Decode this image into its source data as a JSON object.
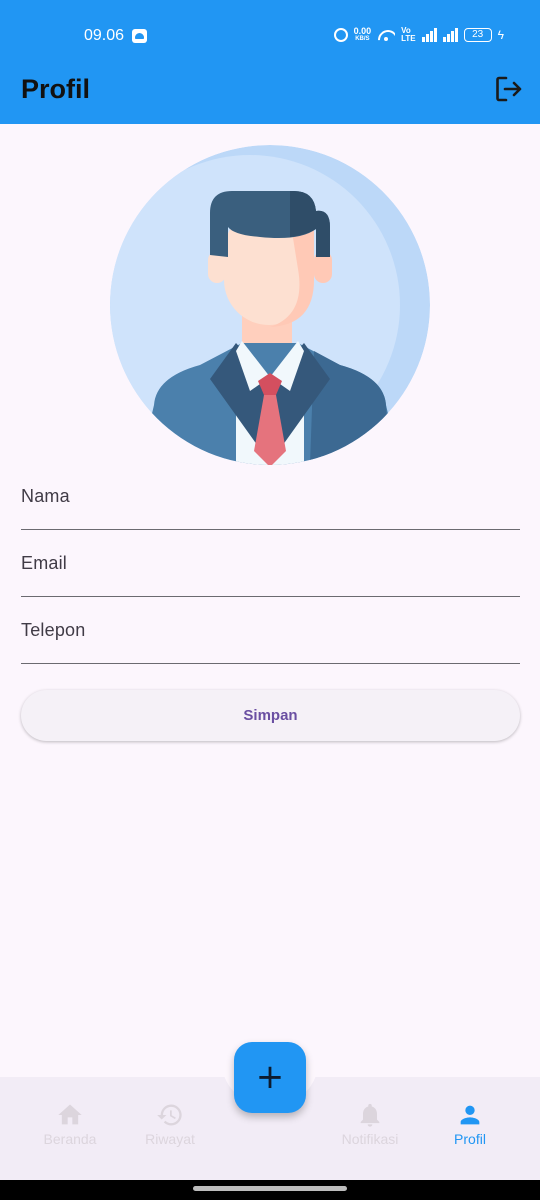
{
  "status_bar": {
    "time": "09.06",
    "net_speed_value": "0.00",
    "net_speed_unit": "KB/S",
    "volte_top": "Vo",
    "volte_bottom": "LTE",
    "battery": "23"
  },
  "app_bar": {
    "title": "Profil",
    "logout_icon": "logout-icon",
    "background_color": "#2196f3"
  },
  "avatar": {
    "icon": "businessman-avatar"
  },
  "form": {
    "fields": [
      {
        "label": "Nama"
      },
      {
        "label": "Email"
      },
      {
        "label": "Telepon"
      }
    ],
    "save_label": "Simpan"
  },
  "fab": {
    "symbol": "+",
    "icon": "add-icon"
  },
  "bottom_nav": {
    "items": [
      {
        "label": "Beranda",
        "icon": "home-icon",
        "active": false
      },
      {
        "label": "Riwayat",
        "icon": "history-icon",
        "active": false
      },
      {
        "label": "Notifikasi",
        "icon": "bell-icon",
        "active": false
      },
      {
        "label": "Profil",
        "icon": "person-icon",
        "active": true
      }
    ],
    "active_color": "#2196f3",
    "inactive_color": "#dcd5dd"
  }
}
